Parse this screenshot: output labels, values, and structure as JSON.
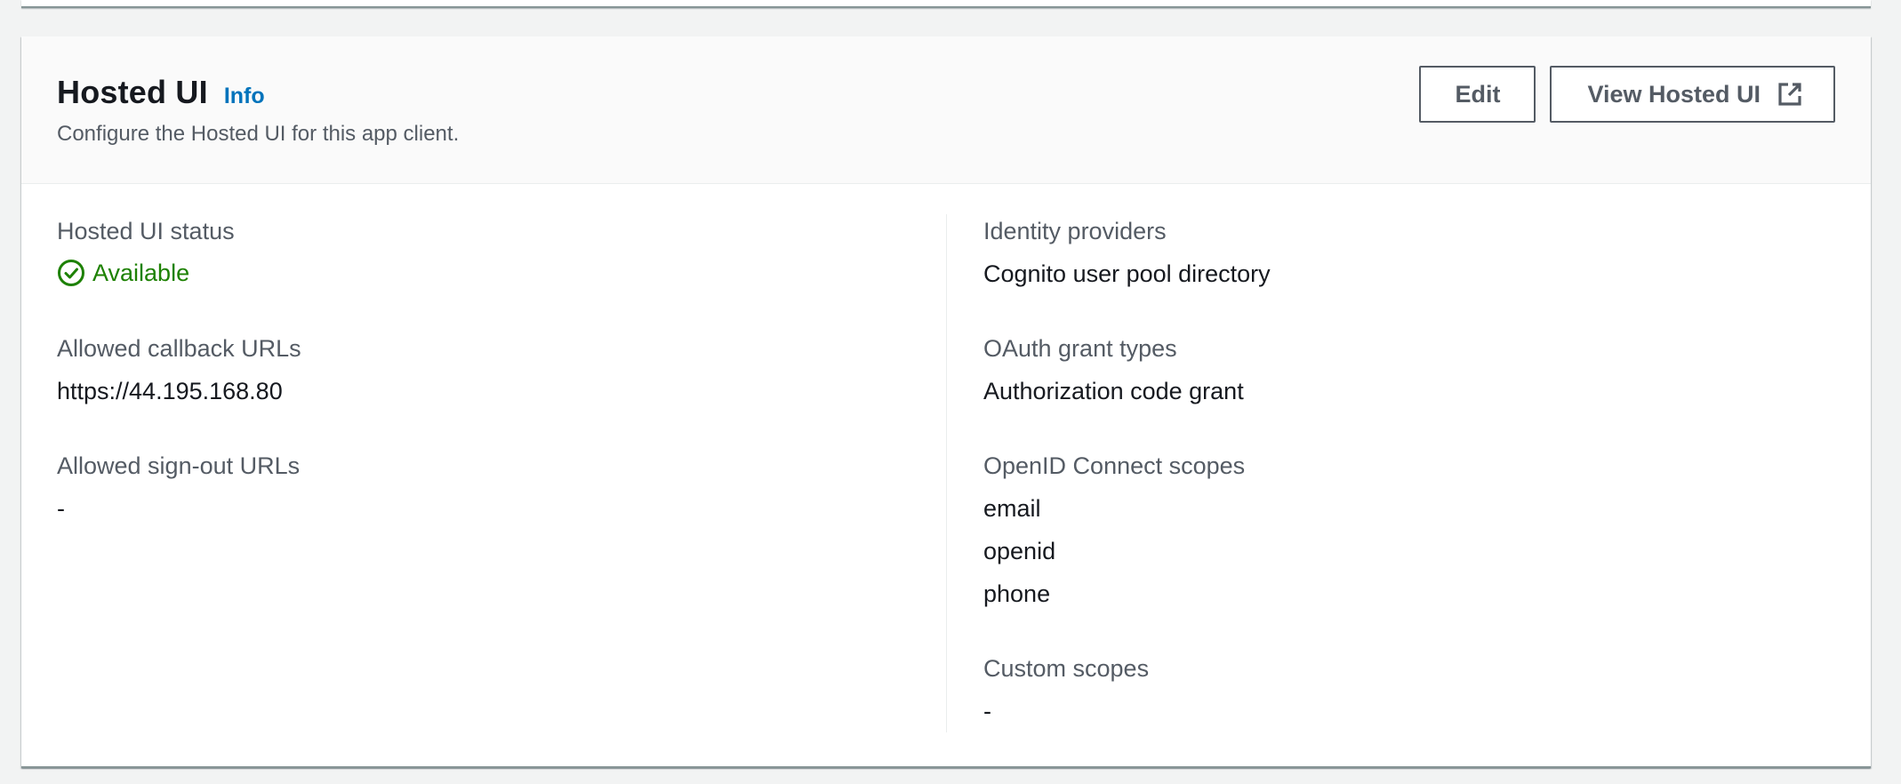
{
  "header": {
    "title": "Hosted UI",
    "info_link": "Info",
    "description": "Configure the Hosted UI for this app client.",
    "edit_label": "Edit",
    "view_label": "View Hosted UI"
  },
  "left": {
    "status_label": "Hosted UI status",
    "status_value": "Available",
    "callback_label": "Allowed callback URLs",
    "callback_value": "https://44.195.168.80",
    "signout_label": "Allowed sign-out URLs",
    "signout_value": "-"
  },
  "right": {
    "idp_label": "Identity providers",
    "idp_value": "Cognito user pool directory",
    "grant_label": "OAuth grant types",
    "grant_value": "Authorization code grant",
    "oidc_label": "OpenID Connect scopes",
    "oidc_scopes": [
      "email",
      "openid",
      "phone"
    ],
    "custom_label": "Custom scopes",
    "custom_value": "-"
  },
  "colors": {
    "success": "#1d8102",
    "link": "#0073bb",
    "muted_text": "#545b64",
    "text": "#16191f"
  },
  "icons": {
    "status": "status-success-icon",
    "external": "external-link-icon"
  }
}
